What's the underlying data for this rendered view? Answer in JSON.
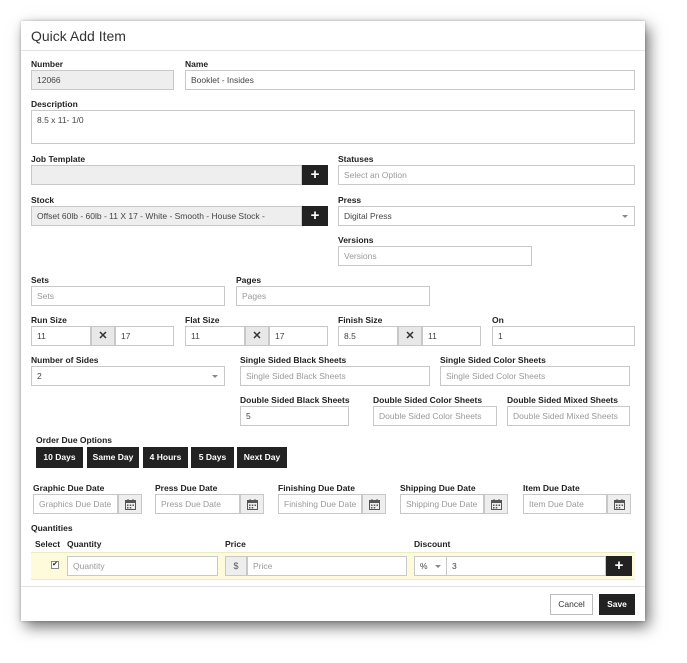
{
  "dialog": {
    "title": "Quick Add Item"
  },
  "number": {
    "label": "Number",
    "value": "12066"
  },
  "name": {
    "label": "Name",
    "value": "Booklet - Insides"
  },
  "description": {
    "label": "Description",
    "value": "8.5 x 11- 1/0"
  },
  "job_template": {
    "label": "Job Template",
    "value": ""
  },
  "statuses": {
    "label": "Statuses",
    "placeholder": "Select an Option"
  },
  "stock": {
    "label": "Stock",
    "value": "Offset 60lb - 60lb - 11 X 17 - White - Smooth   - House Stock -"
  },
  "press": {
    "label": "Press",
    "value": "Digital Press"
  },
  "versions": {
    "label": "Versions",
    "placeholder": "Versions"
  },
  "sets": {
    "label": "Sets",
    "placeholder": "Sets"
  },
  "pages": {
    "label": "Pages",
    "placeholder": "Pages"
  },
  "run_size": {
    "label": "Run Size",
    "width": "11",
    "height": "17"
  },
  "flat_size": {
    "label": "Flat Size",
    "width": "11",
    "height": "17"
  },
  "finish_size": {
    "label": "Finish Size",
    "width": "8.5",
    "height": "11"
  },
  "on": {
    "label": "On",
    "value": "1"
  },
  "x_glyph": "✕",
  "plus_glyph": "+",
  "number_of_sides": {
    "label": "Number of Sides",
    "value": "2"
  },
  "single_black": {
    "label": "Single Sided Black Sheets",
    "placeholder": "Single Sided Black Sheets"
  },
  "single_color": {
    "label": "Single Sided Color Sheets",
    "placeholder": "Single Sided Color Sheets"
  },
  "double_black": {
    "label": "Double Sided Black Sheets",
    "value": "5"
  },
  "double_color": {
    "label": "Double Sided Color Sheets",
    "placeholder": "Double Sided Color Sheets"
  },
  "double_mixed": {
    "label": "Double Sided Mixed Sheets",
    "placeholder": "Double Sided Mixed Sheets"
  },
  "order_due": {
    "label": "Order Due Options",
    "options": [
      "10 Days",
      "Same Day",
      "4 Hours",
      "5 Days",
      "Next Day"
    ]
  },
  "due_dates": {
    "graphic": {
      "label": "Graphic Due Date",
      "placeholder": "Graphics Due Date"
    },
    "press": {
      "label": "Press Due Date",
      "placeholder": "Press Due Date"
    },
    "finishing": {
      "label": "Finishing Due Date",
      "placeholder": "Finishing Due Date"
    },
    "shipping": {
      "label": "Shipping Due Date",
      "placeholder": "Shipping Due Date"
    },
    "item": {
      "label": "Item Due Date",
      "placeholder": "Item Due Date"
    }
  },
  "quantities": {
    "label": "Quantities",
    "col_select": "Select",
    "col_quantity": "Quantity",
    "col_price": "Price",
    "col_discount": "Discount",
    "row": {
      "checked_glyph": "✔",
      "quantity_placeholder": "Quantity",
      "currency": "$",
      "price_placeholder": "Price",
      "discount_type": "%",
      "discount_value": "3"
    }
  },
  "footer": {
    "cancel": "Cancel",
    "save": "Save"
  },
  "colors": {
    "dark": "#222222",
    "row_highlight": "#fdfbdc",
    "readonly": "#eeeeee"
  },
  "icons": [
    "plus-icon",
    "times-icon",
    "calendar-icon",
    "chevron-down-icon",
    "check-icon"
  ]
}
